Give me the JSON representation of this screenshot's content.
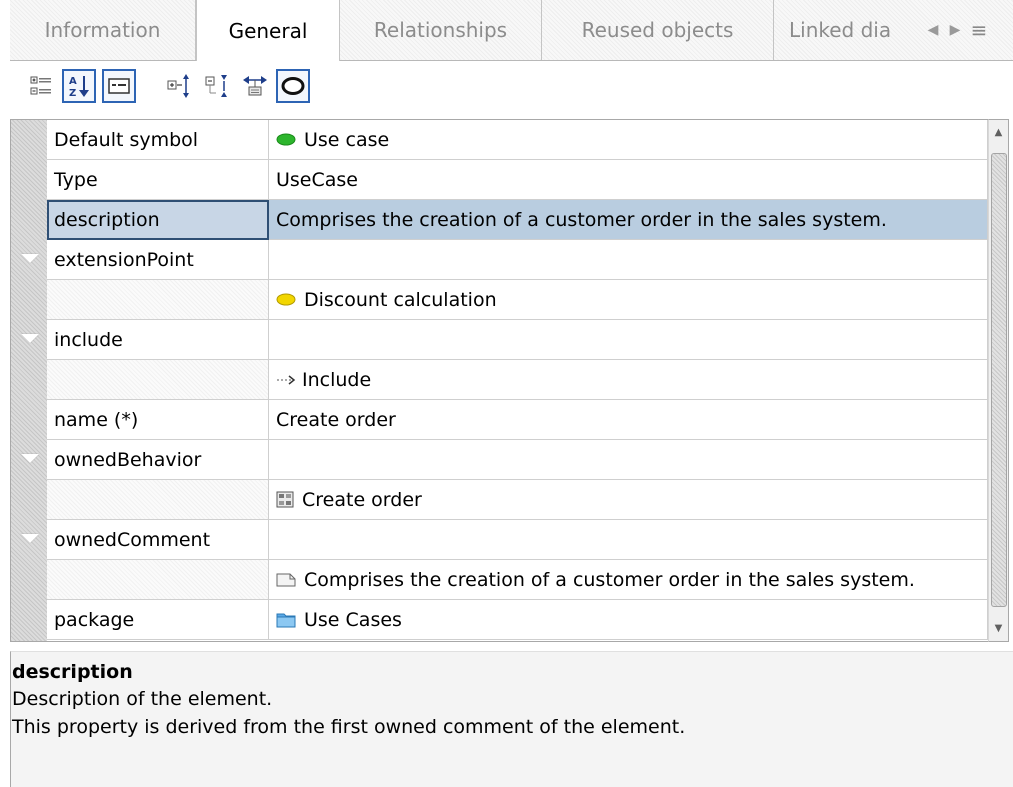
{
  "tabs": [
    {
      "label": "Information",
      "active": false
    },
    {
      "label": "General",
      "active": true
    },
    {
      "label": "Relationships",
      "active": false
    },
    {
      "label": "Reused objects",
      "active": false
    },
    {
      "label": "Linked dia",
      "active": false
    }
  ],
  "toolbar": {
    "buttons": [
      {
        "name": "categorized-view-icon",
        "pressed": false
      },
      {
        "name": "sort-alphabetical-icon",
        "pressed": true
      },
      {
        "name": "show-description-icon",
        "pressed": true
      },
      {
        "name": "expand-all-icon",
        "pressed": false
      },
      {
        "name": "collapse-all-icon",
        "pressed": false
      },
      {
        "name": "filter-properties-icon",
        "pressed": false
      },
      {
        "name": "show-all-eye-icon",
        "pressed": true
      }
    ]
  },
  "properties": [
    {
      "name": "Default symbol",
      "value": "Use case",
      "icon": "use-case-green-ellipse-icon"
    },
    {
      "name": "Type",
      "value": "UseCase"
    },
    {
      "name": "description",
      "value": "Comprises the creation of a customer order in the sales system.",
      "selected": true
    },
    {
      "name": "extensionPoint",
      "value": "",
      "expandable": true
    },
    {
      "name": "",
      "value": "Discount calculation",
      "icon": "extension-point-yellow-ellipse-icon"
    },
    {
      "name": "include",
      "value": "",
      "expandable": true
    },
    {
      "name": "",
      "value": "Include",
      "icon": "include-arrow-icon"
    },
    {
      "name": "name (*)",
      "value": "Create order"
    },
    {
      "name": "ownedBehavior",
      "value": "",
      "expandable": true
    },
    {
      "name": "",
      "value": "Create order",
      "icon": "behavior-icon"
    },
    {
      "name": "ownedComment",
      "value": "",
      "expandable": true
    },
    {
      "name": "",
      "value": "Comprises the creation of a customer order in the sales system.",
      "icon": "comment-icon"
    },
    {
      "name": "package",
      "value": "Use Cases",
      "icon": "package-folder-icon"
    }
  ],
  "description_pane": {
    "title": "description",
    "lines": [
      "Description of the element.",
      "This property is derived from the first owned comment of the element."
    ]
  },
  "colors": {
    "accent": "#2d64b4",
    "selection": "#b9cde0",
    "use_case_green": "#2db52d",
    "extension_point_yellow": "#f2d600",
    "package_blue": "#5aa9e6"
  }
}
